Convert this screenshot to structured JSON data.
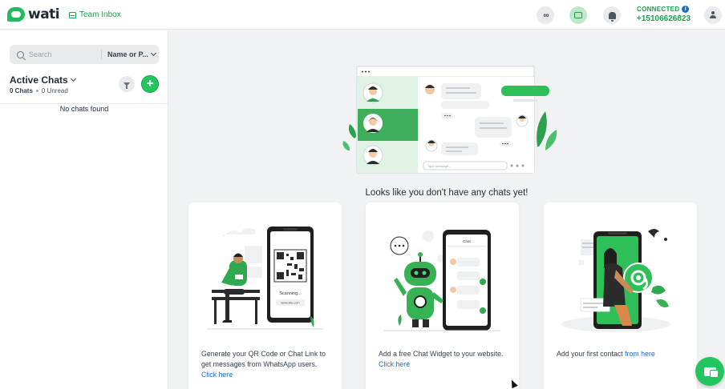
{
  "brand": {
    "name": "wati"
  },
  "header": {
    "team_inbox": "Team Inbox",
    "status_label": "CONNECTED",
    "info_badge": "i",
    "phone": "+15106626823",
    "meta_glyph": "∞",
    "icons": [
      "meta-icon",
      "wallet-icon",
      "bell-icon",
      "user-icon"
    ]
  },
  "sidebar": {
    "search_placeholder": "Search",
    "sort_value": "Name or P...",
    "section_title": "Active Chats",
    "chats_count": "0 Chats",
    "unread_count": "0 Unread",
    "empty_text": "No chats found",
    "add_label": "+"
  },
  "main": {
    "empty_title": "Looks like you don't have any chats yet!",
    "cards": [
      {
        "text": "Generate your QR Code or Chat Link to get messages from WhatsApp users.",
        "link": "Click here",
        "art_scanning": "Scanning...",
        "art_url": "www.site.com"
      },
      {
        "text": "Add a free Chat Widget to your website.",
        "link": "Click here",
        "art_header": "Chat"
      },
      {
        "text": "Add your first contact",
        "link": "from here"
      }
    ],
    "hero_input_placeholder": "Type message..."
  },
  "colors": {
    "brand_green": "#22c55e",
    "link_blue": "#1d6ec9",
    "connected_green": "#16a34a"
  }
}
